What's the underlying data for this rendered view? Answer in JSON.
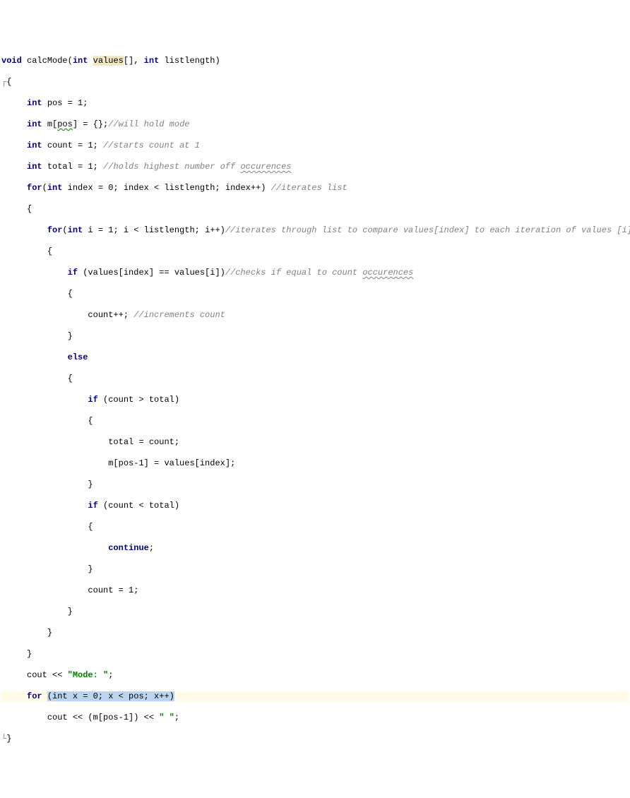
{
  "chart_data": null,
  "code": {
    "fn_sig_prefix": "void",
    "fn_name": "calcMode",
    "fn_params_open": "(",
    "fn_param1_type": "int",
    "fn_param1_name": "values",
    "fn_param1_suffix": "[], ",
    "fn_param2_type": "int",
    "fn_param2_name": "listlength",
    "fn_params_close": ")",
    "brace_open": "{",
    "l1_type": "int",
    "l1_rest": " pos = 1;",
    "l2_type": "int",
    "l2_mid": " m[",
    "l2_pos": "pos",
    "l2_rest": "] = {};",
    "l2_cmt": "//will hold mode",
    "l3_type": "int",
    "l3_rest": " count = 1; ",
    "l3_cmt": "//starts count at 1",
    "l4_type": "int",
    "l4_rest": " total = 1; ",
    "l4_cmt_pre": "//holds highest number off ",
    "l4_cmt_sq": "occurences",
    "l5_for": "for",
    "l5_paren": "(",
    "l5_int": "int",
    "l5_rest": " index = 0; index < listlength; index++) ",
    "l5_cmt": "//iterates list",
    "l6_brace": "{",
    "l7_for": "for",
    "l7_paren": "(",
    "l7_int": "int",
    "l7_rest": " i = 1; i < listlength; i++)",
    "l7_cmt": "//iterates through list to compare values[index] to each iteration of values [i]",
    "l8_brace": "{",
    "l9_if": "if",
    "l9_rest": " (values[index] == values[i])",
    "l9_cmt_pre": "//checks if equal to count ",
    "l9_cmt_sq": "occurences",
    "l10_brace": "{",
    "l11_rest": "count++; ",
    "l11_cmt": "//increments count",
    "l12_brace": "}",
    "l13_else": "else",
    "l14_brace": "{",
    "l15_if": "if",
    "l15_rest": " (count > total)",
    "l16_brace": "{",
    "l17_rest": "total = count;",
    "l18_rest": "m[pos-1] = values[index];",
    "l19_brace": "}",
    "l20_if": "if",
    "l20_rest": " (count < total)",
    "l21_brace": "{",
    "l22_cont": "continue",
    "l22_semi": ";",
    "l23_brace": "}",
    "l24_rest": "count = 1;",
    "l25_brace": "}",
    "l26_brace": "}",
    "l27_brace": "}",
    "l28_cout": "cout << ",
    "l28_str": "\"Mode: \"",
    "l28_semi": ";",
    "l29_for": "for",
    "l29_space": " ",
    "l29_paren_int": "(int",
    "l29_body": " x = 0; x < pos; x++)",
    "l30_rest": "cout << (m[pos-1]) << ",
    "l30_str": "\" \"",
    "l30_semi": ";",
    "brace_close": "}",
    "gutter_open": "┌",
    "gutter_close": "└"
  }
}
